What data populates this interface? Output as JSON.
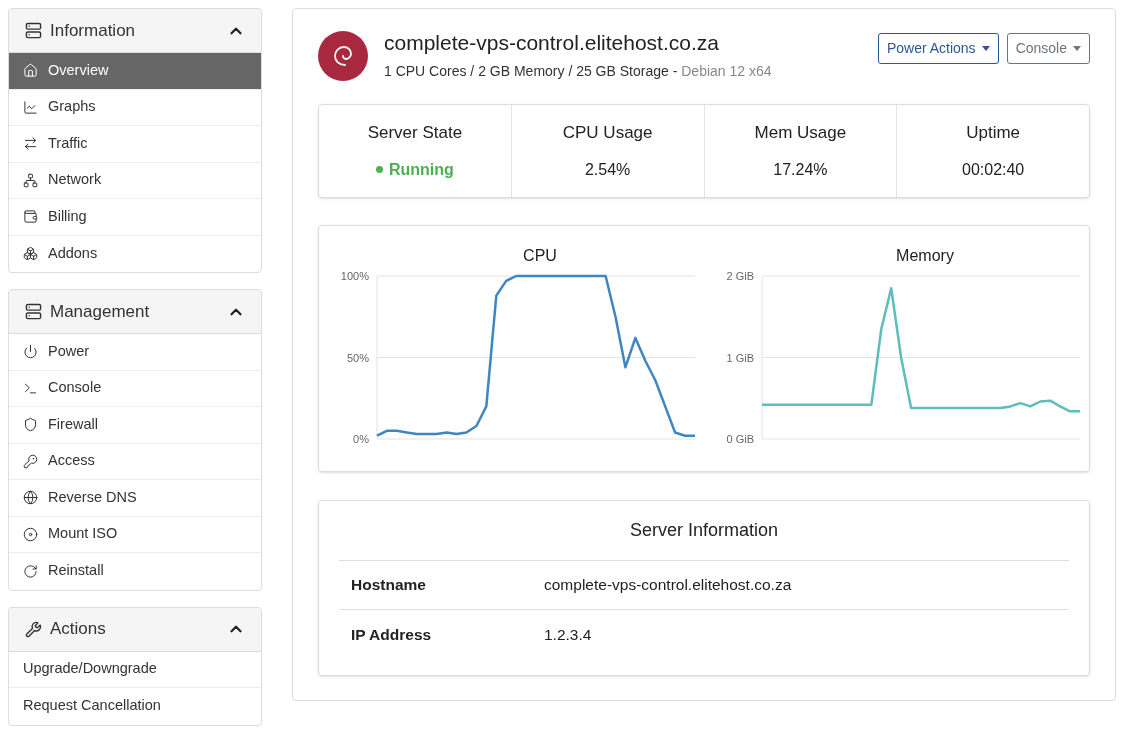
{
  "sidebar": [
    {
      "title": "Information",
      "expanded": true,
      "items": [
        {
          "label": "Overview",
          "selected": true
        },
        {
          "label": "Graphs",
          "selected": false
        },
        {
          "label": "Traffic",
          "selected": false
        },
        {
          "label": "Network",
          "selected": false
        },
        {
          "label": "Billing",
          "selected": false
        },
        {
          "label": "Addons",
          "selected": false
        }
      ]
    },
    {
      "title": "Management",
      "expanded": true,
      "items": [
        {
          "label": "Power",
          "selected": false
        },
        {
          "label": "Console",
          "selected": false
        },
        {
          "label": "Firewall",
          "selected": false
        },
        {
          "label": "Access",
          "selected": false
        },
        {
          "label": "Reverse DNS",
          "selected": false
        },
        {
          "label": "Mount ISO",
          "selected": false
        },
        {
          "label": "Reinstall",
          "selected": false
        }
      ]
    },
    {
      "title": "Actions",
      "expanded": true,
      "items": [
        {
          "label": "Upgrade/Downgrade",
          "selected": false
        },
        {
          "label": "Request Cancellation",
          "selected": false
        }
      ]
    }
  ],
  "server": {
    "hostname": "complete-vps-control.elitehost.co.za",
    "specs": "1 CPU Cores / 2 GB Memory / 25 GB Storage",
    "separator": "-",
    "os": "Debian 12 x64"
  },
  "buttons": [
    {
      "label": "Power Actions",
      "kind": "primary"
    },
    {
      "label": "Console",
      "kind": "secondary"
    }
  ],
  "stats": [
    {
      "label": "Server State",
      "value": "Running",
      "kind": "status"
    },
    {
      "label": "CPU Usage",
      "value": "2.54%",
      "kind": "plain"
    },
    {
      "label": "Mem Usage",
      "value": "17.24%",
      "kind": "plain"
    },
    {
      "label": "Uptime",
      "value": "00:02:40",
      "kind": "plain"
    }
  ],
  "charts": [
    {
      "chart_data": {
        "type": "line",
        "title": "CPU",
        "series": [
          {
            "color": "#3f86c0",
            "values": [
              2,
              5,
              5,
              4,
              3,
              3,
              3,
              4,
              3,
              4,
              8,
              20,
              88,
              97,
              100,
              100,
              100,
              100,
              100,
              100,
              100,
              100,
              100,
              100,
              75,
              44,
              62,
              48,
              36,
              20,
              4,
              2,
              2
            ]
          }
        ],
        "ylim": [
          0,
          100
        ],
        "yticks": [
          {
            "value": 0,
            "label": "0%"
          },
          {
            "value": 50,
            "label": "50%"
          },
          {
            "value": 100,
            "label": "100%"
          }
        ]
      }
    },
    {
      "chart_data": {
        "type": "line",
        "title": "Memory",
        "series": [
          {
            "color": "#5dbdbb",
            "values": [
              0.42,
              0.42,
              0.42,
              0.42,
              0.42,
              0.42,
              0.42,
              0.42,
              0.42,
              0.42,
              0.42,
              0.42,
              1.35,
              1.85,
              1.0,
              0.38,
              0.38,
              0.38,
              0.38,
              0.38,
              0.38,
              0.38,
              0.38,
              0.38,
              0.38,
              0.4,
              0.44,
              0.4,
              0.46,
              0.47,
              0.4,
              0.34,
              0.34
            ]
          }
        ],
        "ylim": [
          0,
          2
        ],
        "yticks": [
          {
            "value": 0,
            "label": "0 GiB"
          },
          {
            "value": 1,
            "label": "1 GiB"
          },
          {
            "value": 2,
            "label": "2 GiB"
          }
        ]
      }
    }
  ],
  "info": {
    "title": "Server Information",
    "rows": [
      {
        "label": "Hostname",
        "value": "complete-vps-control.elitehost.co.za"
      },
      {
        "label": "IP Address",
        "value": "1.2.3.4"
      }
    ]
  }
}
